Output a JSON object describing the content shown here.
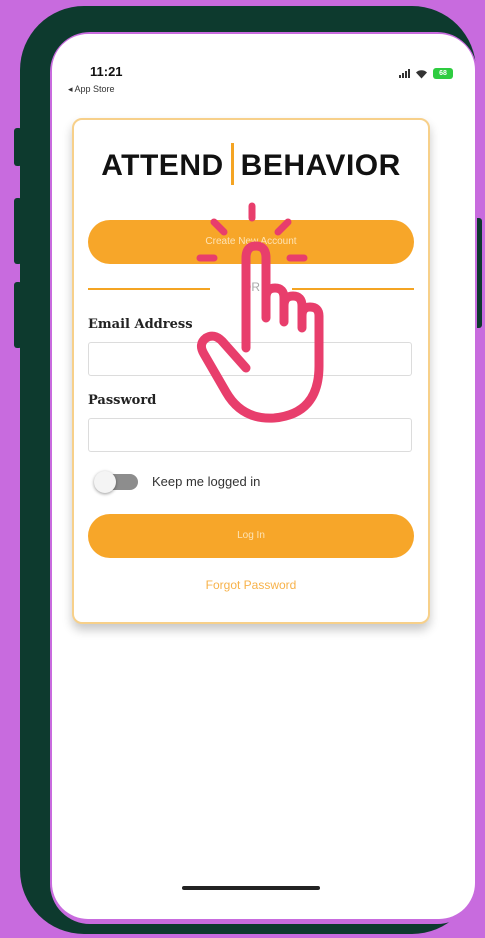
{
  "status_bar": {
    "time": "11:21",
    "back_label": "◂ App Store",
    "battery": "68"
  },
  "logo": {
    "left": "ATTEND",
    "right": "BEHAVIOR",
    "accent_color": "#f4a423"
  },
  "form": {
    "create_account_label": "Create New Account",
    "divider_text": "OR",
    "email_label": "Email Address",
    "email_value": "",
    "password_label": "Password",
    "password_value": "",
    "keep_logged_in_label": "Keep me logged in",
    "keep_logged_in_on": false,
    "login_label": "Log In",
    "forgot_password_label": "Forgot Password"
  },
  "icons": {
    "hand_pointer": "tap-hand-icon"
  },
  "colors": {
    "background": "#c86bde",
    "phone_frame": "#0d3a2e",
    "button": "#f7a629",
    "hand": "#e83e6c"
  }
}
